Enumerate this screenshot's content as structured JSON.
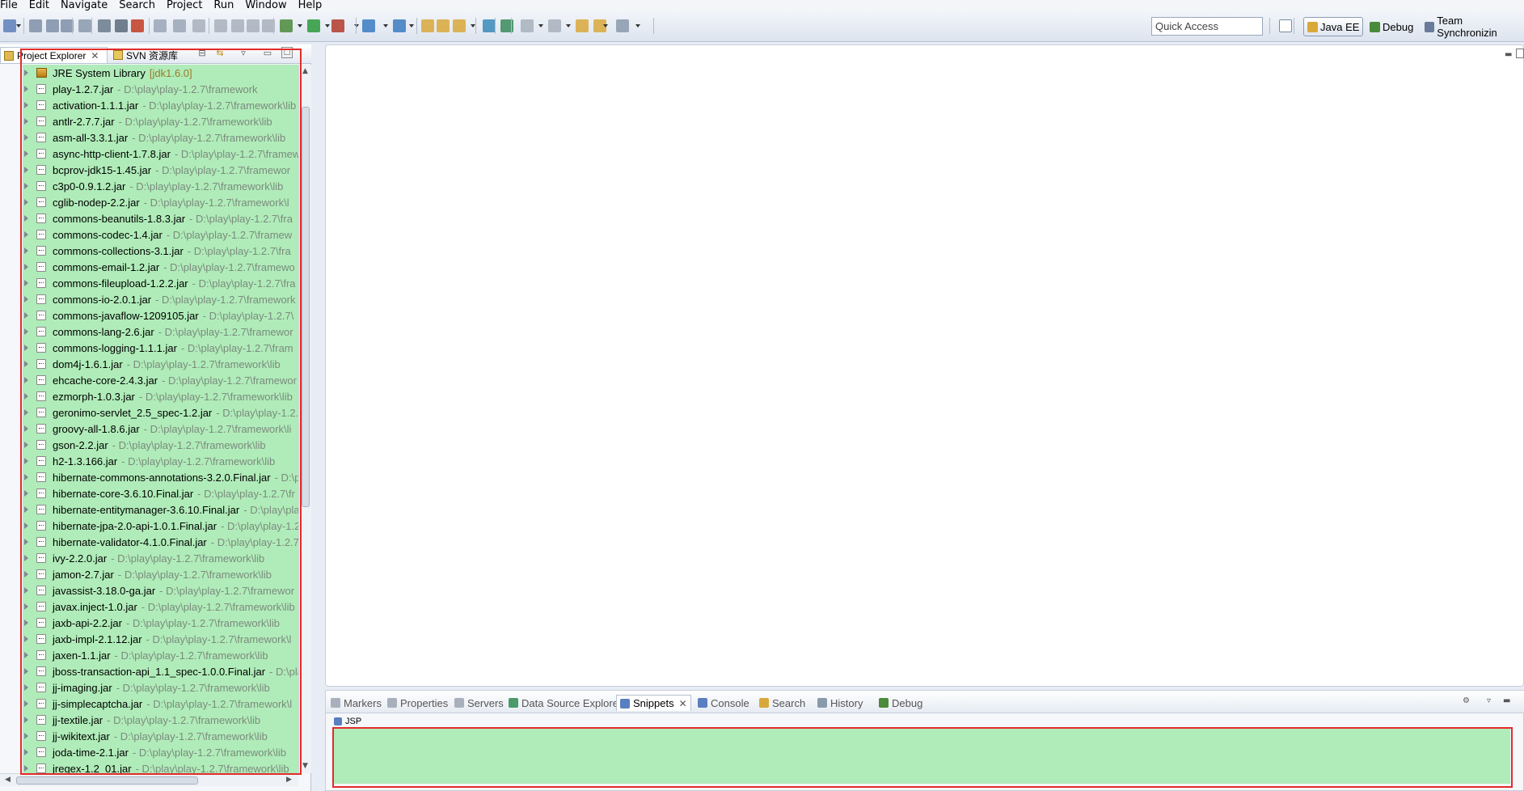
{
  "menu": [
    "File",
    "Edit",
    "Navigate",
    "Search",
    "Project",
    "Run",
    "Window",
    "Help"
  ],
  "toolbar": {
    "quick_access_placeholder": "Quick Access",
    "perspectives": [
      {
        "label": "Java EE",
        "active": true
      },
      {
        "label": "Debug",
        "active": false
      },
      {
        "label": "Team Synchronizin",
        "active": false
      }
    ]
  },
  "explorer": {
    "tabs": [
      {
        "label": "Project Explorer",
        "active": true
      },
      {
        "label": "SVN 资源库",
        "active": false
      }
    ],
    "items": [
      {
        "name": "JRE System Library",
        "extra": "[jdk1.6.0]",
        "kind": "library"
      },
      {
        "name": "play-1.2.7.jar",
        "extra": "- D:\\play\\play-1.2.7\\framework",
        "kind": "jar"
      },
      {
        "name": "activation-1.1.1.jar",
        "extra": "- D:\\play\\play-1.2.7\\framework\\lib",
        "kind": "jar"
      },
      {
        "name": "antlr-2.7.7.jar",
        "extra": "- D:\\play\\play-1.2.7\\framework\\lib",
        "kind": "jar"
      },
      {
        "name": "asm-all-3.3.1.jar",
        "extra": "- D:\\play\\play-1.2.7\\framework\\lib",
        "kind": "jar"
      },
      {
        "name": "async-http-client-1.7.8.jar",
        "extra": "- D:\\play\\play-1.2.7\\framew",
        "kind": "jar"
      },
      {
        "name": "bcprov-jdk15-1.45.jar",
        "extra": "- D:\\play\\play-1.2.7\\framewor",
        "kind": "jar"
      },
      {
        "name": "c3p0-0.9.1.2.jar",
        "extra": "- D:\\play\\play-1.2.7\\framework\\lib",
        "kind": "jar"
      },
      {
        "name": "cglib-nodep-2.2.jar",
        "extra": "- D:\\play\\play-1.2.7\\framework\\l",
        "kind": "jar"
      },
      {
        "name": "commons-beanutils-1.8.3.jar",
        "extra": "- D:\\play\\play-1.2.7\\fra",
        "kind": "jar"
      },
      {
        "name": "commons-codec-1.4.jar",
        "extra": "- D:\\play\\play-1.2.7\\framew",
        "kind": "jar"
      },
      {
        "name": "commons-collections-3.1.jar",
        "extra": "- D:\\play\\play-1.2.7\\fra",
        "kind": "jar"
      },
      {
        "name": "commons-email-1.2.jar",
        "extra": "- D:\\play\\play-1.2.7\\framewo",
        "kind": "jar"
      },
      {
        "name": "commons-fileupload-1.2.2.jar",
        "extra": "- D:\\play\\play-1.2.7\\fra",
        "kind": "jar"
      },
      {
        "name": "commons-io-2.0.1.jar",
        "extra": "- D:\\play\\play-1.2.7\\framework",
        "kind": "jar"
      },
      {
        "name": "commons-javaflow-1209105.jar",
        "extra": "- D:\\play\\play-1.2.7\\",
        "kind": "jar"
      },
      {
        "name": "commons-lang-2.6.jar",
        "extra": "- D:\\play\\play-1.2.7\\framewor",
        "kind": "jar"
      },
      {
        "name": "commons-logging-1.1.1.jar",
        "extra": "- D:\\play\\play-1.2.7\\fram",
        "kind": "jar"
      },
      {
        "name": "dom4j-1.6.1.jar",
        "extra": "- D:\\play\\play-1.2.7\\framework\\lib",
        "kind": "jar"
      },
      {
        "name": "ehcache-core-2.4.3.jar",
        "extra": "- D:\\play\\play-1.2.7\\framewor",
        "kind": "jar"
      },
      {
        "name": "ezmorph-1.0.3.jar",
        "extra": "- D:\\play\\play-1.2.7\\framework\\lib",
        "kind": "jar"
      },
      {
        "name": "geronimo-servlet_2.5_spec-1.2.jar",
        "extra": "- D:\\play\\play-1.2.",
        "kind": "jar"
      },
      {
        "name": "groovy-all-1.8.6.jar",
        "extra": "- D:\\play\\play-1.2.7\\framework\\li",
        "kind": "jar"
      },
      {
        "name": "gson-2.2.jar",
        "extra": "- D:\\play\\play-1.2.7\\framework\\lib",
        "kind": "jar"
      },
      {
        "name": "h2-1.3.166.jar",
        "extra": "- D:\\play\\play-1.2.7\\framework\\lib",
        "kind": "jar"
      },
      {
        "name": "hibernate-commons-annotations-3.2.0.Final.jar",
        "extra": "- D:\\p",
        "kind": "jar"
      },
      {
        "name": "hibernate-core-3.6.10.Final.jar",
        "extra": "- D:\\play\\play-1.2.7\\fr",
        "kind": "jar"
      },
      {
        "name": "hibernate-entitymanager-3.6.10.Final.jar",
        "extra": "- D:\\play\\pla",
        "kind": "jar"
      },
      {
        "name": "hibernate-jpa-2.0-api-1.0.1.Final.jar",
        "extra": "- D:\\play\\play-1.2",
        "kind": "jar"
      },
      {
        "name": "hibernate-validator-4.1.0.Final.jar",
        "extra": "- D:\\play\\play-1.2.7",
        "kind": "jar"
      },
      {
        "name": "ivy-2.2.0.jar",
        "extra": "- D:\\play\\play-1.2.7\\framework\\lib",
        "kind": "jar"
      },
      {
        "name": "jamon-2.7.jar",
        "extra": "- D:\\play\\play-1.2.7\\framework\\lib",
        "kind": "jar"
      },
      {
        "name": "javassist-3.18.0-ga.jar",
        "extra": "- D:\\play\\play-1.2.7\\framewor",
        "kind": "jar"
      },
      {
        "name": "javax.inject-1.0.jar",
        "extra": "- D:\\play\\play-1.2.7\\framework\\lib",
        "kind": "jar"
      },
      {
        "name": "jaxb-api-2.2.jar",
        "extra": "- D:\\play\\play-1.2.7\\framework\\lib",
        "kind": "jar"
      },
      {
        "name": "jaxb-impl-2.1.12.jar",
        "extra": "- D:\\play\\play-1.2.7\\framework\\l",
        "kind": "jar"
      },
      {
        "name": "jaxen-1.1.jar",
        "extra": "- D:\\play\\play-1.2.7\\framework\\lib",
        "kind": "jar"
      },
      {
        "name": "jboss-transaction-api_1.1_spec-1.0.0.Final.jar",
        "extra": "- D:\\pla",
        "kind": "jar"
      },
      {
        "name": "jj-imaging.jar",
        "extra": "- D:\\play\\play-1.2.7\\framework\\lib",
        "kind": "jar"
      },
      {
        "name": "jj-simplecaptcha.jar",
        "extra": "- D:\\play\\play-1.2.7\\framework\\l",
        "kind": "jar"
      },
      {
        "name": "jj-textile.jar",
        "extra": "- D:\\play\\play-1.2.7\\framework\\lib",
        "kind": "jar"
      },
      {
        "name": "jj-wikitext.jar",
        "extra": "- D:\\play\\play-1.2.7\\framework\\lib",
        "kind": "jar"
      },
      {
        "name": "joda-time-2.1.jar",
        "extra": "- D:\\play\\play-1.2.7\\framework\\lib",
        "kind": "jar"
      },
      {
        "name": "jregex-1.2_01.jar",
        "extra": "- D:\\play\\play-1.2.7\\framework\\lib",
        "kind": "jar"
      }
    ]
  },
  "bottom": {
    "tabs": [
      {
        "label": "Markers",
        "active": false,
        "icon": "markers-icon"
      },
      {
        "label": "Properties",
        "active": false,
        "icon": "properties-icon"
      },
      {
        "label": "Servers",
        "active": false,
        "icon": "servers-icon"
      },
      {
        "label": "Data Source Explorer",
        "active": false,
        "icon": "data-source-icon"
      },
      {
        "label": "Snippets",
        "active": true,
        "icon": "snippets-icon"
      },
      {
        "label": "Console",
        "active": false,
        "icon": "console-icon"
      },
      {
        "label": "Search",
        "active": false,
        "icon": "search-icon"
      },
      {
        "label": "History",
        "active": false,
        "icon": "history-icon"
      },
      {
        "label": "Debug",
        "active": false,
        "icon": "debug-icon"
      }
    ],
    "snippet_category": "JSP"
  },
  "colors": {
    "highlight_green": "#b0ecb9",
    "highlight_border": "#e32b2b"
  }
}
